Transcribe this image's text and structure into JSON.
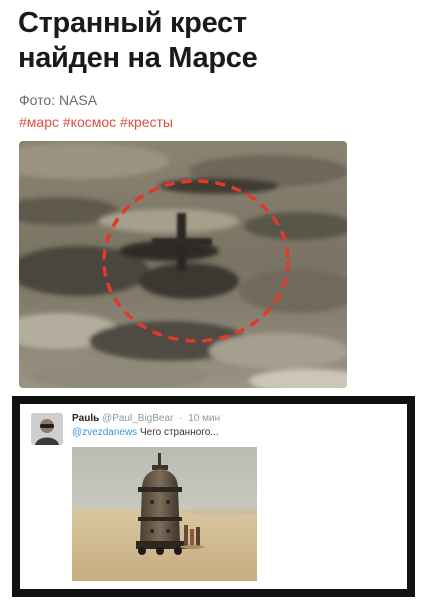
{
  "article": {
    "headline_line1": "Странный крест",
    "headline_line2": "найден на Марсе",
    "credit": "Фото: NASA",
    "tags": "#марс #космос #кресты"
  },
  "mars_photo": {
    "highlight_color": "#e03a2a",
    "description_icon": "dashed-circle-highlight"
  },
  "tweet": {
    "author": "Paulь",
    "handle": "@Paul_BigBear",
    "separator": "·",
    "time": "10 мин",
    "mention": "@zvezdanews",
    "text": "Чего странного..."
  },
  "colors": {
    "hashtag": "#d94f3f",
    "mention": "#3b94d9",
    "frame": "#111111"
  }
}
